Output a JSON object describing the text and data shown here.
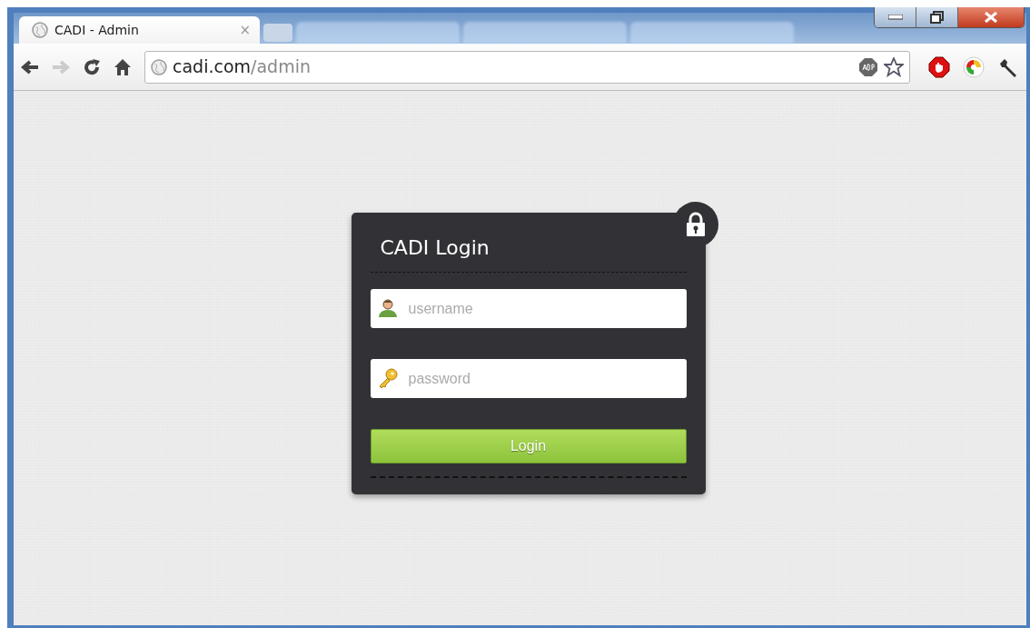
{
  "tabs": [
    {
      "title": "CADI - Admin",
      "close": "×",
      "selected": true
    }
  ],
  "address_bar": {
    "host": "cadi.com",
    "path": "/admin"
  },
  "nav": {
    "forward_disabled": true
  },
  "login": {
    "title": "CADI Login",
    "fields": [
      {
        "kind": "text",
        "placeholder": "username"
      },
      {
        "kind": "password",
        "placeholder": "password"
      }
    ],
    "button": "Login"
  }
}
